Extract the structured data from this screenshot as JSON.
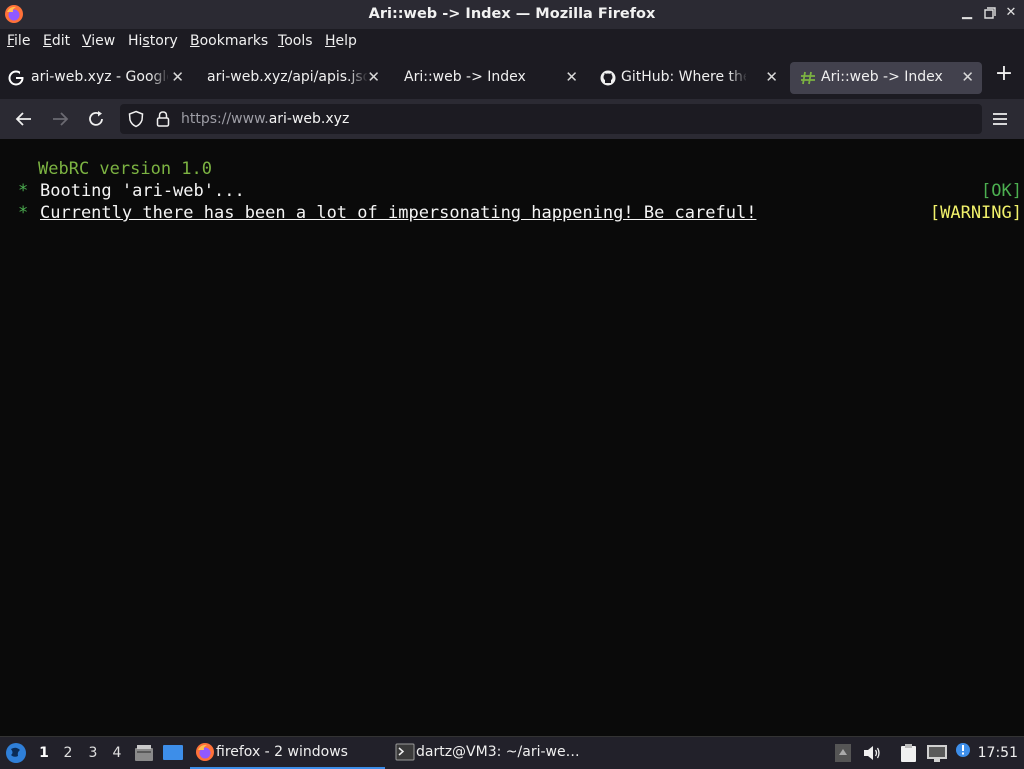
{
  "window": {
    "title": "Ari::web -> Index — Mozilla Firefox",
    "controls": [
      "minimize-icon",
      "restore-icon",
      "close-icon"
    ]
  },
  "menubar": {
    "items": [
      {
        "key": "F",
        "rest": "ile"
      },
      {
        "key": "E",
        "rest": "dit"
      },
      {
        "key": "V",
        "rest": "iew"
      },
      {
        "pre": "Hi",
        "key": "s",
        "rest": "tory"
      },
      {
        "key": "B",
        "rest": "ookmarks"
      },
      {
        "key": "T",
        "rest": "ools"
      },
      {
        "key": "H",
        "rest": "elp"
      }
    ]
  },
  "tabs": [
    {
      "title": "ari-web.xyz - Google",
      "icon": "google-icon"
    },
    {
      "title": "ari-web.xyz/api/apis.json",
      "icon": "none"
    },
    {
      "title": "Ari::web -> Index",
      "icon": "none"
    },
    {
      "title": "GitHub: Where the world builds software",
      "icon": "github-icon"
    },
    {
      "title": "Ari::web -> Index",
      "icon": "hash-icon",
      "active": true
    }
  ],
  "navbar": {
    "url_prefix": "https://www.",
    "url_domain": "ari-web.xyz"
  },
  "terminal": {
    "header": "WebRC version 1.0",
    "bullet": "*",
    "line1": "Booting 'ari-web'...",
    "line1_status": "[OK]",
    "line2": "Currently there has been a lot of impersonating happening! Be careful!",
    "line2_status": "[WARNING]"
  },
  "taskbar": {
    "workspaces": [
      "1",
      "2",
      "3",
      "4"
    ],
    "active_workspace": "1",
    "tasks": [
      {
        "label": "firefox - 2 windows",
        "icon": "firefox-icon",
        "active": true
      },
      {
        "label": "dartz@VM3: ~/ari-we…",
        "icon": "terminal-icon"
      }
    ],
    "clock": "17:51"
  },
  "colors": {
    "accent": "#3d8ee9",
    "ok": "#4caf50",
    "warning": "#f1f16b",
    "header_green": "#7cb342"
  }
}
